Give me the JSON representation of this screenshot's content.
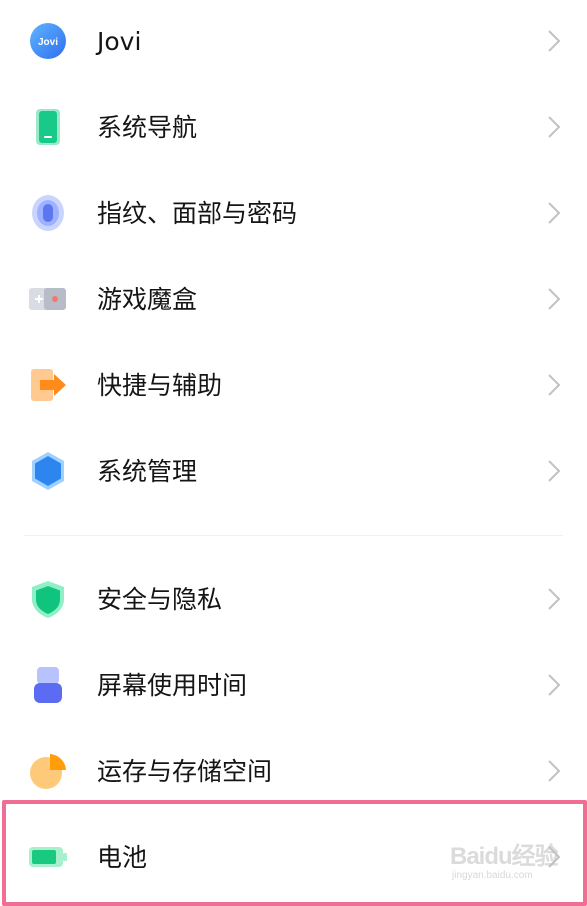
{
  "settings_list": {
    "items": [
      {
        "id": "jovi",
        "label": "Jovi",
        "icon": "jovi-icon",
        "icon_text": "Jovi"
      },
      {
        "id": "system-navigation",
        "label": "系统导航",
        "icon": "phone-icon"
      },
      {
        "id": "fingerprint-face-password",
        "label": "指纹、面部与密码",
        "icon": "fingerprint-icon"
      },
      {
        "id": "game-box",
        "label": "游戏魔盒",
        "icon": "gamepad-icon"
      },
      {
        "id": "shortcuts-accessibility",
        "label": "快捷与辅助",
        "icon": "arrow-right-icon"
      },
      {
        "id": "system-management",
        "label": "系统管理",
        "icon": "hexagon-icon"
      },
      {
        "id": "security-privacy",
        "label": "安全与隐私",
        "icon": "shield-icon"
      },
      {
        "id": "screen-time",
        "label": "屏幕使用时间",
        "icon": "hourglass-icon"
      },
      {
        "id": "ram-storage",
        "label": "运存与存储空间",
        "icon": "pie-chart-icon"
      },
      {
        "id": "battery",
        "label": "电池",
        "icon": "battery-icon"
      }
    ]
  },
  "highlight": {
    "target": "battery",
    "color": "#f06d93"
  },
  "watermark": {
    "text": "Baidu经验",
    "subtext": "jingyan.baidu.com"
  },
  "colors": {
    "chevron": "#c2c2c2",
    "divider": "#efefef",
    "text": "#151515"
  }
}
